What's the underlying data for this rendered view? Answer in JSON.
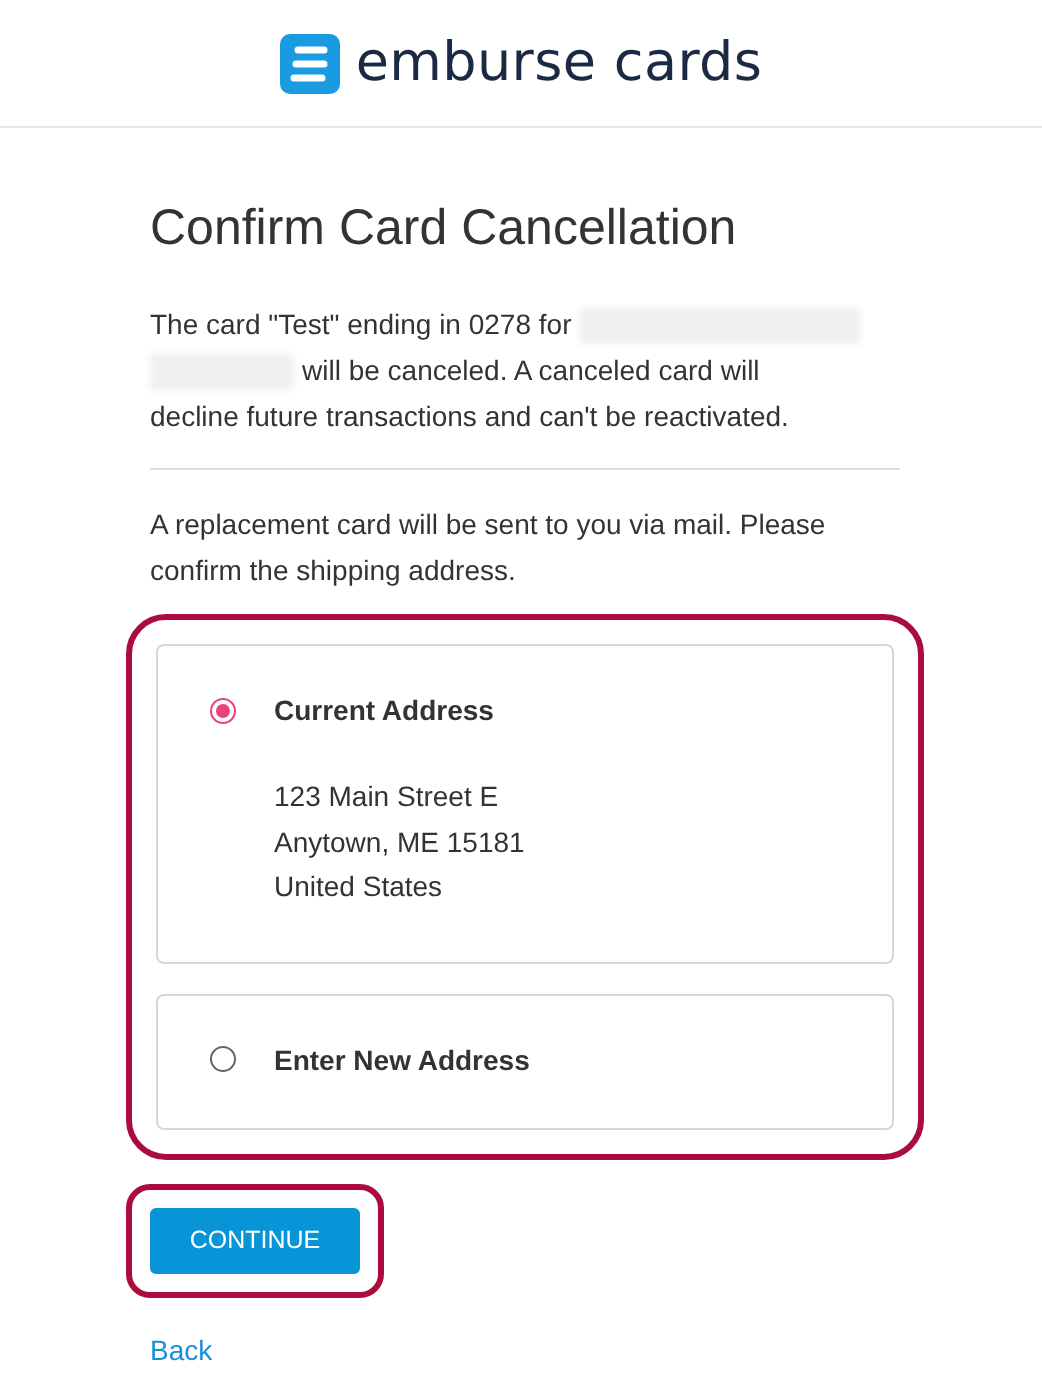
{
  "header": {
    "logo_text": "emburse cards"
  },
  "title": "Confirm Card Cancellation",
  "notice": {
    "before_redaction": "The card \"Test\" ending in 0278 for",
    "after_redaction": "will be canceled. A canceled card will",
    "last_line": "decline future transactions and can't be reactivated."
  },
  "shipping_prompt": "A replacement card will be sent to you via mail. Please confirm the shipping address.",
  "address_options": {
    "highlighted": true,
    "options": [
      {
        "label": "Current Address",
        "selected": true,
        "address_lines": [
          "123 Main Street E",
          "Anytown, ME 15181",
          "United States"
        ]
      },
      {
        "label": "Enter New Address",
        "selected": false
      }
    ]
  },
  "continue_button": {
    "label": "CONTINUE",
    "highlighted": true
  },
  "back_link": "Back"
}
